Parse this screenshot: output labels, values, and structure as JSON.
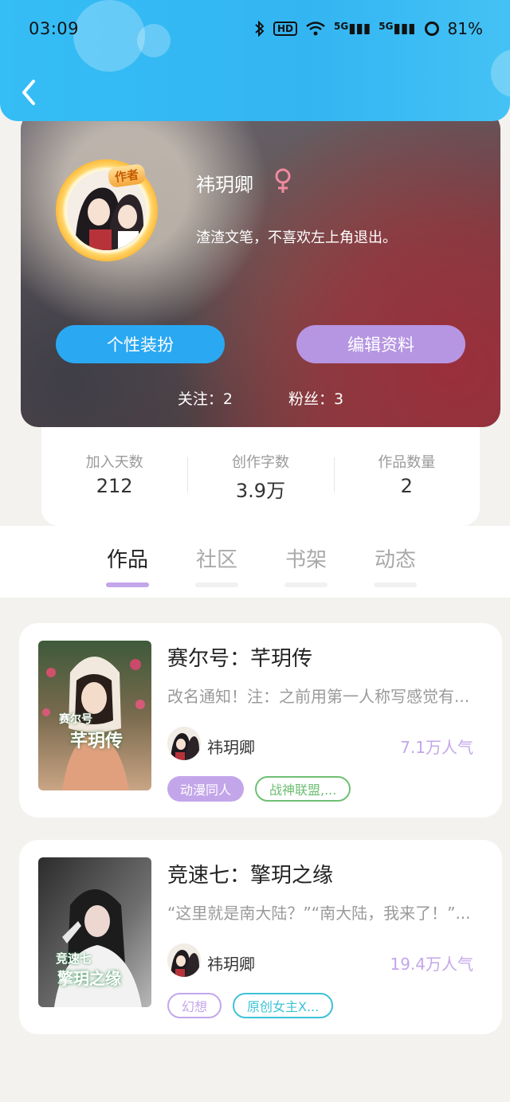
{
  "status_bar": {
    "time": "03:09",
    "battery": "81%",
    "bluetooth_icon": "bluetooth-icon",
    "hd_badge": "HD",
    "net1": "5G",
    "net2": "5G"
  },
  "profile": {
    "name": "祎玥卿",
    "gender_symbol": "♀",
    "author_badge": "作者",
    "bio": "渣渣文笔，不喜欢左上角退出。",
    "dress_button": "个性装扮",
    "edit_button": "编辑资料",
    "follow": "关注：2",
    "fans": "粉丝：3"
  },
  "stats": [
    {
      "label": "加入天数",
      "value": "212"
    },
    {
      "label": "创作字数",
      "value": "3.9万"
    },
    {
      "label": "作品数量",
      "value": "2"
    }
  ],
  "tabs": [
    {
      "label": "作品",
      "active": true
    },
    {
      "label": "社区",
      "active": false
    },
    {
      "label": "书架",
      "active": false
    },
    {
      "label": "动态",
      "active": false
    }
  ],
  "books": [
    {
      "title": "赛尔号：芊玥传",
      "desc": "改名通知！注：之前用第一人称写感觉有...",
      "author": "祎玥卿",
      "popularity": "7.1万人气",
      "cover_text": "芊玥传",
      "cover_sub": "赛尔号",
      "tags": [
        {
          "label": "动漫同人",
          "color": "#c3a6ea",
          "filled": true
        },
        {
          "label": "战神联盟,...",
          "color": "#6fbf73",
          "filled": false
        }
      ]
    },
    {
      "title": "竞速七：擎玥之缘",
      "desc": "“这里就是南大陆？”“南大陆，我来了！”...",
      "author": "祎玥卿",
      "popularity": "19.4万人气",
      "cover_text": "擎玥之缘",
      "cover_sub": "竞速七",
      "tags": [
        {
          "label": "幻想",
          "color": "#c3a6ea",
          "filled": false
        },
        {
          "label": "原创女主X...",
          "color": "#3cc3d6",
          "filled": false
        }
      ]
    }
  ],
  "colors": {
    "header": "#35bdf5",
    "accent_purple": "#c3a6ea",
    "accent_blue": "#2aa8f2"
  }
}
